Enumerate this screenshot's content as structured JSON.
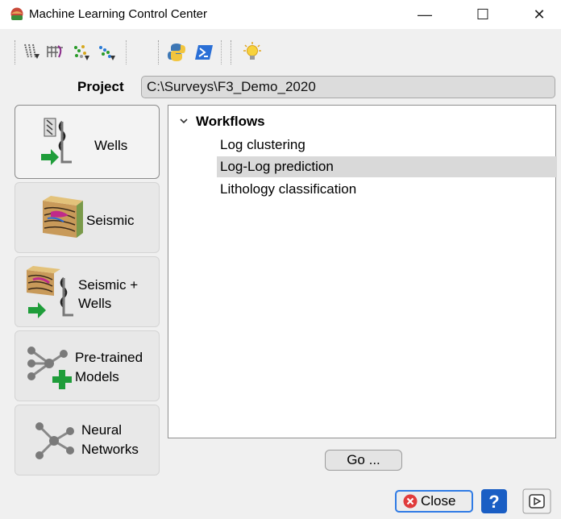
{
  "window": {
    "title": "Machine Learning Control Center",
    "minimize_glyph": "—",
    "maximize_glyph": "☐",
    "close_glyph": "✕"
  },
  "toolbar": {
    "icons": [
      "well-log-import-icon",
      "log-export-icon",
      "cluster-points-icon",
      "scatter-import-icon",
      "python-icon",
      "powershell-icon",
      "lightbulb-icon"
    ]
  },
  "project": {
    "label": "Project",
    "path": "C:\\Surveys\\F3_Demo_2020"
  },
  "sidebar": {
    "items": [
      {
        "id": "wells",
        "label": "Wells",
        "active": true
      },
      {
        "id": "seismic",
        "label": "Seismic",
        "active": false
      },
      {
        "id": "seismic-wells",
        "label_line1": "Seismic +",
        "label_line2": "Wells",
        "active": false
      },
      {
        "id": "pretrained",
        "label_line1": "Pre-trained",
        "label_line2": "Models",
        "active": false
      },
      {
        "id": "neural",
        "label_line1": "Neural",
        "label_line2": "Networks",
        "active": false
      }
    ]
  },
  "tree": {
    "root": "Workflows",
    "items": [
      "Log clustering",
      "Log-Log prediction",
      "Lithology classification"
    ],
    "selected_index": 1
  },
  "buttons": {
    "go": "Go ...",
    "close": "Close",
    "help": "?"
  },
  "colors": {
    "accent": "#2f7be5",
    "close_red": "#e03b3b",
    "green_arrow": "#1f9d3a",
    "selection": "#d9d9d9"
  }
}
